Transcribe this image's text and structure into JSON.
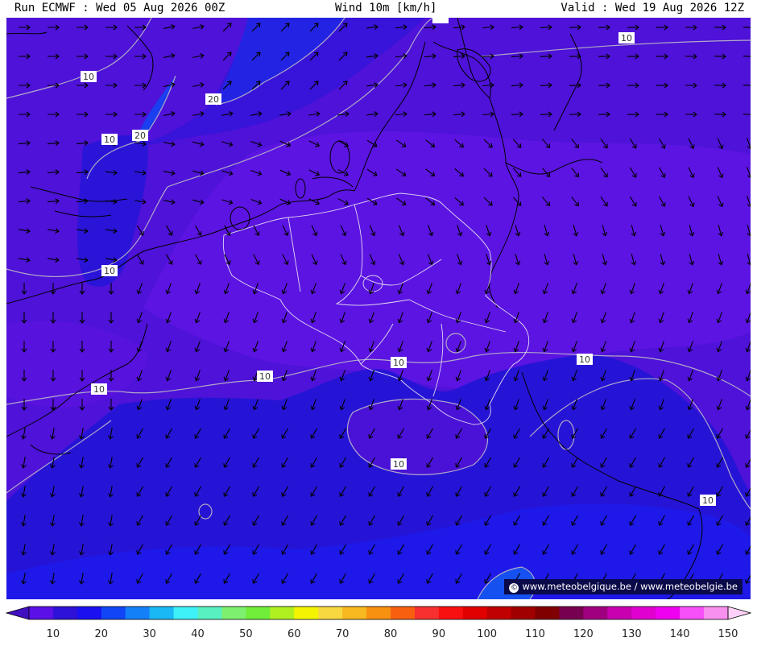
{
  "header": {
    "run": "Run ECMWF : Wed 05 Aug 2026 00Z",
    "title": "Wind 10m [km/h]",
    "valid": "Valid : Wed 19 Aug 2026 12Z"
  },
  "map": {
    "contour_labels": [
      "10",
      "20"
    ],
    "credit": "www.meteobelgique.be / www.meteobelgie.be",
    "credit_icon": "copyright-icon"
  },
  "legend": {
    "ticks": [
      "10",
      "20",
      "30",
      "40",
      "50",
      "60",
      "70",
      "80",
      "90",
      "100",
      "110",
      "120",
      "130",
      "140",
      "150"
    ],
    "colors": [
      "#5a10e6",
      "#2f12d8",
      "#1a10f0",
      "#1046f5",
      "#1480f8",
      "#1ab8f5",
      "#3ef0f8",
      "#58f0c0",
      "#7ef070",
      "#70ee3a",
      "#b0f020",
      "#f4f400",
      "#f8d840",
      "#f8b820",
      "#f89010",
      "#f86010",
      "#f83030",
      "#f81010",
      "#e00000",
      "#c00000",
      "#a00000",
      "#800000",
      "#780050",
      "#a00080",
      "#c800b0",
      "#e000d0",
      "#f000f0",
      "#f850f8",
      "#f890f0"
    ],
    "end_low": "#4010c0",
    "end_high": "#ffd0f8"
  }
}
